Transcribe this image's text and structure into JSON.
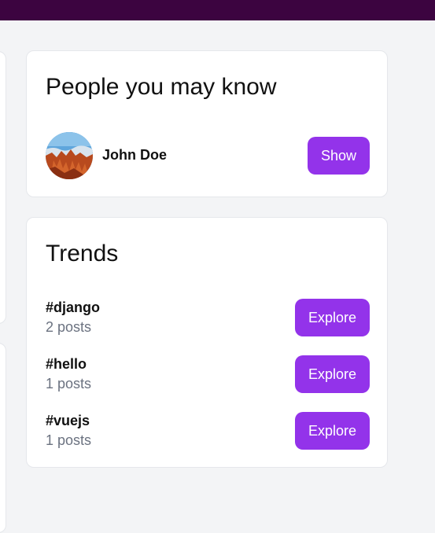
{
  "people_card": {
    "title": "People you may know",
    "people": [
      {
        "name": "John Doe",
        "action_label": "Show"
      }
    ]
  },
  "trends_card": {
    "title": "Trends",
    "items": [
      {
        "tag": "#django",
        "count": "2 posts",
        "action_label": "Explore"
      },
      {
        "tag": "#hello",
        "count": "1 posts",
        "action_label": "Explore"
      },
      {
        "tag": "#vuejs",
        "count": "1 posts",
        "action_label": "Explore"
      }
    ]
  },
  "colors": {
    "topbar": "#3c0440",
    "accent": "#9333ea",
    "background": "#f3f4f6",
    "muted_text": "#6b7280"
  }
}
